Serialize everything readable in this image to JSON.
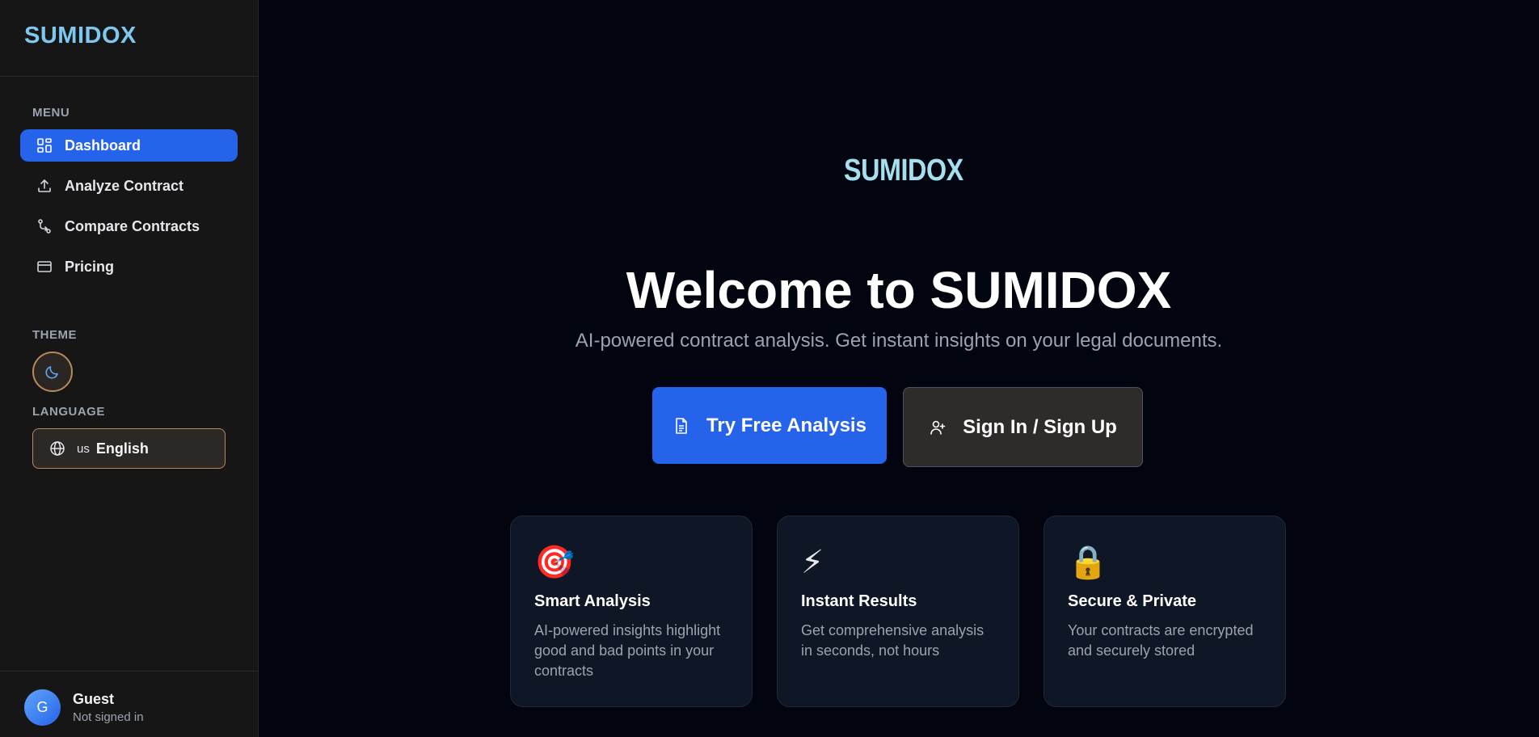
{
  "sidebar": {
    "brand": "SUMIDOX",
    "menu_label": "MENU",
    "items": [
      {
        "label": "Dashboard",
        "icon": "dashboard-grid-icon"
      },
      {
        "label": "Analyze Contract",
        "icon": "upload-icon"
      },
      {
        "label": "Compare Contracts",
        "icon": "git-compare-icon"
      },
      {
        "label": "Pricing",
        "icon": "credit-card-icon"
      }
    ],
    "theme_label": "THEME",
    "theme_icon": "moon-icon",
    "language_label": "LANGUAGE",
    "language": {
      "flag": "us",
      "name": "English",
      "icon": "globe-icon"
    },
    "user": {
      "initial": "G",
      "name": "Guest",
      "status": "Not signed in"
    }
  },
  "main": {
    "logo": "SUMIDOX",
    "title": "Welcome to SUMIDOX",
    "subtitle": "AI-powered contract analysis. Get instant insights on your legal documents.",
    "primary_button": "Try Free Analysis",
    "secondary_button": "Sign In / Sign Up",
    "features": [
      {
        "emoji": "🎯",
        "title": "Smart Analysis",
        "desc": "AI-powered insights highlight good and bad points in your contracts"
      },
      {
        "emoji": "⚡",
        "title": "Instant Results",
        "desc": "Get comprehensive analysis in seconds, not hours"
      },
      {
        "emoji": "🔒",
        "title": "Secure & Private",
        "desc": "Your contracts are encrypted and securely stored"
      }
    ]
  },
  "colors": {
    "accent": "#2563eb",
    "background": "#02050f",
    "sidebar": "#161616",
    "brand": "#7ec8f0"
  }
}
